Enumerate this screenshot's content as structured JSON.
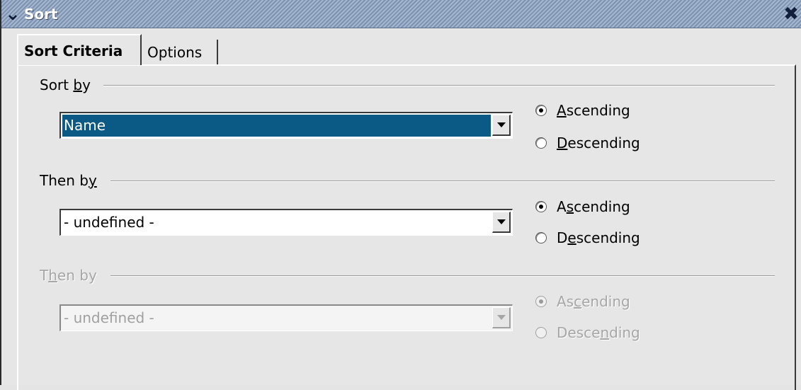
{
  "window": {
    "title": "Sort",
    "menu_icon": "chevron-down-icon",
    "close_icon": "close-icon"
  },
  "tabs": [
    {
      "label": "Sort Criteria",
      "active": true
    },
    {
      "label": "Options",
      "active": false
    }
  ],
  "groups": [
    {
      "label_pre": "Sort ",
      "label_mn": "b",
      "label_post": "y",
      "enabled": true,
      "selected_value": "Name",
      "highlighted": true,
      "ascending": {
        "pre": "",
        "mn": "A",
        "post": "scending",
        "checked": true
      },
      "descending": {
        "pre": "",
        "mn": "D",
        "post": "escending",
        "checked": false
      }
    },
    {
      "label_pre": "Then b",
      "label_mn": "y",
      "label_post": "",
      "enabled": true,
      "selected_value": "- undefined -",
      "highlighted": false,
      "ascending": {
        "pre": "A",
        "mn": "s",
        "post": "cending",
        "checked": true
      },
      "descending": {
        "pre": "D",
        "mn": "e",
        "post": "scending",
        "checked": false
      }
    },
    {
      "label_pre": "T",
      "label_mn": "h",
      "label_post": "en by",
      "enabled": false,
      "selected_value": "- undefined -",
      "highlighted": false,
      "ascending": {
        "pre": "As",
        "mn": "c",
        "post": "ending",
        "checked": true
      },
      "descending": {
        "pre": "Desce",
        "mn": "n",
        "post": "ding",
        "checked": false
      }
    }
  ],
  "colors": {
    "selection": "#0b5a86",
    "titlebar": "#8fa2bf",
    "disabled_text": "#a6a6a6"
  }
}
